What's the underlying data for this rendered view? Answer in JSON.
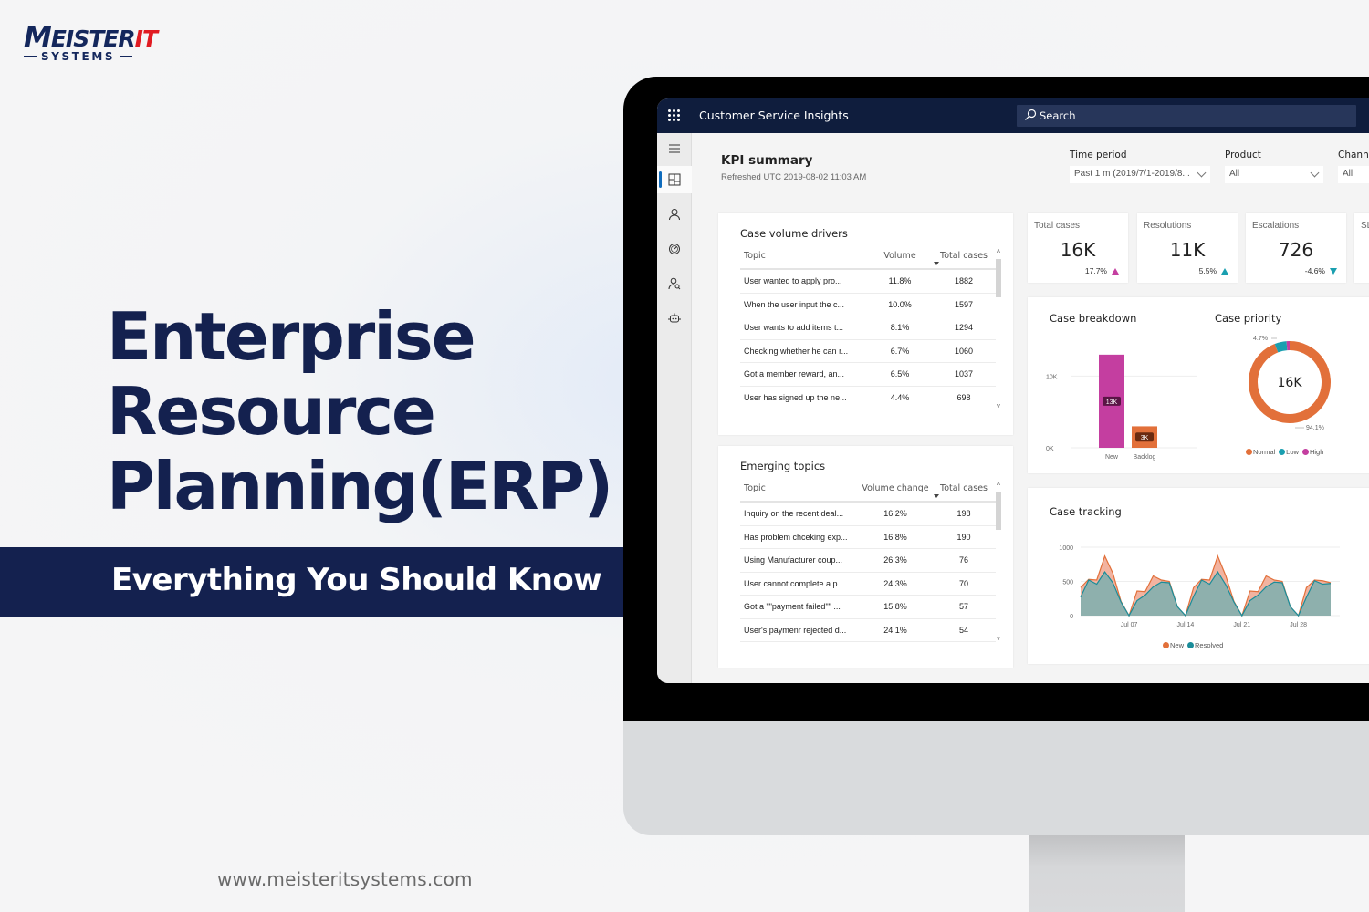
{
  "brand": {
    "logo_main_first": "M",
    "logo_main_rest": "EISTER",
    "logo_main_accent": "IT",
    "logo_sub": "SYSTEMS",
    "colors": {
      "navy": "#14214f",
      "red": "#e11b22"
    }
  },
  "hero": {
    "title_lines": [
      "Enterprise",
      "Resource",
      "Planning(ERP)"
    ],
    "subtitle": "Everything You Should Know",
    "website": "www.meisteritsystems.com"
  },
  "app": {
    "title": "Customer Service Insights",
    "search_placeholder": "Search",
    "nav": [
      {
        "icon": "hamburger-menu-icon"
      },
      {
        "icon": "dashboard-icon",
        "active": true
      },
      {
        "icon": "person-icon"
      },
      {
        "icon": "gauge-icon"
      },
      {
        "icon": "person-search-icon"
      },
      {
        "icon": "bot-icon"
      }
    ],
    "kpi_summary": {
      "title": "KPI summary",
      "refreshed": "Refreshed UTC 2019-08-02 11:03 AM"
    },
    "filters": [
      {
        "label": "Time period",
        "value": "Past 1 m (2019/7/1-2019/8..."
      },
      {
        "label": "Product",
        "value": "All"
      },
      {
        "label": "Channe",
        "value": "All"
      }
    ],
    "case_volume_drivers": {
      "title": "Case volume drivers",
      "columns": [
        "Topic",
        "Volume",
        "Total cases"
      ],
      "rows": [
        [
          "User wanted to apply pro...",
          "11.8%",
          "1882"
        ],
        [
          "When the user input the c...",
          "10.0%",
          "1597"
        ],
        [
          "User wants to add items t...",
          "8.1%",
          "1294"
        ],
        [
          "Checking whether he can r...",
          "6.7%",
          "1060"
        ],
        [
          "Got a member reward, an...",
          "6.5%",
          "1037"
        ],
        [
          "User has signed up the ne...",
          "4.4%",
          "698"
        ]
      ]
    },
    "emerging_topics": {
      "title": "Emerging topics",
      "columns": [
        "Topic",
        "Volume change",
        "Total cases"
      ],
      "rows": [
        [
          "Inquiry on the recent deal...",
          "16.2%",
          "198"
        ],
        [
          "Has problem chceking exp...",
          "16.8%",
          "190"
        ],
        [
          "Using Manufacturer coup...",
          "26.3%",
          "76"
        ],
        [
          "User cannot complete a p...",
          "24.3%",
          "70"
        ],
        [
          "Got a \"\"payment failed\"\" ...",
          "15.8%",
          "57"
        ],
        [
          "User's paymenr rejected d...",
          "24.1%",
          "54"
        ]
      ]
    },
    "kpis": [
      {
        "label": "Total cases",
        "value": "16K",
        "delta": "17.7%",
        "direction": "up",
        "color": "#c43ea0"
      },
      {
        "label": "Resolutions",
        "value": "11K",
        "delta": "5.5%",
        "direction": "up",
        "color": "#1a9fb0"
      },
      {
        "label": "Escalations",
        "value": "726",
        "delta": "-4.6%",
        "direction": "down",
        "color": "#1a9fb0"
      },
      {
        "label": "SL",
        "value": "",
        "delta": "",
        "direction": "",
        "color": ""
      }
    ]
  },
  "chart_data": [
    {
      "type": "bar",
      "title": "Case breakdown",
      "categories": [
        "New",
        "Backlog"
      ],
      "values": [
        13000,
        3000
      ],
      "data_labels": [
        "13K",
        "3K"
      ],
      "colors": [
        "#c43ea0",
        "#e2703a"
      ],
      "yticks": [
        "0K",
        "10K"
      ],
      "ylim": [
        0,
        14000
      ]
    },
    {
      "type": "pie",
      "title": "Case priority",
      "center_label": "16K",
      "labels": [
        "Normal",
        "Low",
        "High"
      ],
      "values": [
        94.1,
        4.7,
        1.2
      ],
      "colors": [
        "#e2703a",
        "#1a9fb0",
        "#c43ea0"
      ],
      "annotations": [
        "4.7%",
        "94.1%"
      ],
      "legend": "bottom"
    },
    {
      "type": "area",
      "title": "Case tracking",
      "x_ticks": [
        "Jul 07",
        "Jul 14",
        "Jul 21",
        "Jul 28"
      ],
      "yticks": [
        "0",
        "500",
        "1000"
      ],
      "ylim": [
        0,
        1000
      ],
      "series": [
        {
          "name": "New",
          "color": "#e2703a",
          "values": [
            410,
            530,
            520,
            870,
            620,
            210,
            0,
            360,
            350,
            580,
            520,
            500,
            130,
            0,
            410,
            530,
            520,
            870,
            580,
            210,
            0,
            360,
            350,
            580,
            520,
            500,
            130,
            0,
            410,
            520,
            510,
            480
          ]
        },
        {
          "name": "Resolved",
          "color": "#1a8c99",
          "values": [
            270,
            520,
            460,
            640,
            480,
            200,
            0,
            220,
            300,
            420,
            490,
            480,
            130,
            0,
            280,
            520,
            460,
            640,
            450,
            200,
            0,
            220,
            300,
            420,
            490,
            480,
            130,
            0,
            270,
            510,
            460,
            470
          ]
        }
      ],
      "legend": "bottom"
    }
  ]
}
